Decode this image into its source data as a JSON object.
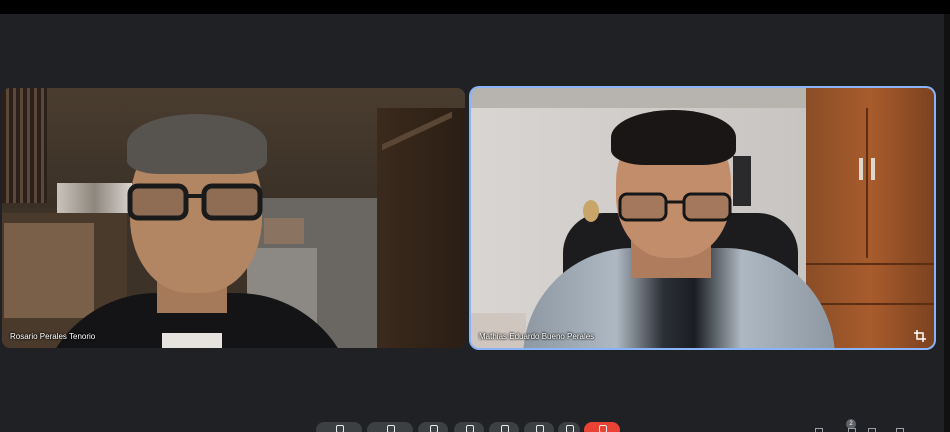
{
  "app": "Video call",
  "participants": [
    {
      "name": "Rosario Perales Tenorio"
    },
    {
      "name": "Mathias Eduardo Bueno Perales"
    }
  ],
  "participant_badge_count": "2",
  "colors": {
    "background": "#202124",
    "active_speaker_outline": "#8ab4f8",
    "end_call": "#ea4335",
    "control_button": "#3c4043"
  },
  "icons": {
    "tile_action": "crop-icon",
    "controls": [
      "mic-icon",
      "camera-icon",
      "captions-icon",
      "emoji-icon",
      "present-icon",
      "raise-hand-icon",
      "more-options-icon",
      "end-call-icon"
    ],
    "side": [
      "info-icon",
      "people-icon",
      "chat-icon",
      "activities-icon"
    ]
  }
}
